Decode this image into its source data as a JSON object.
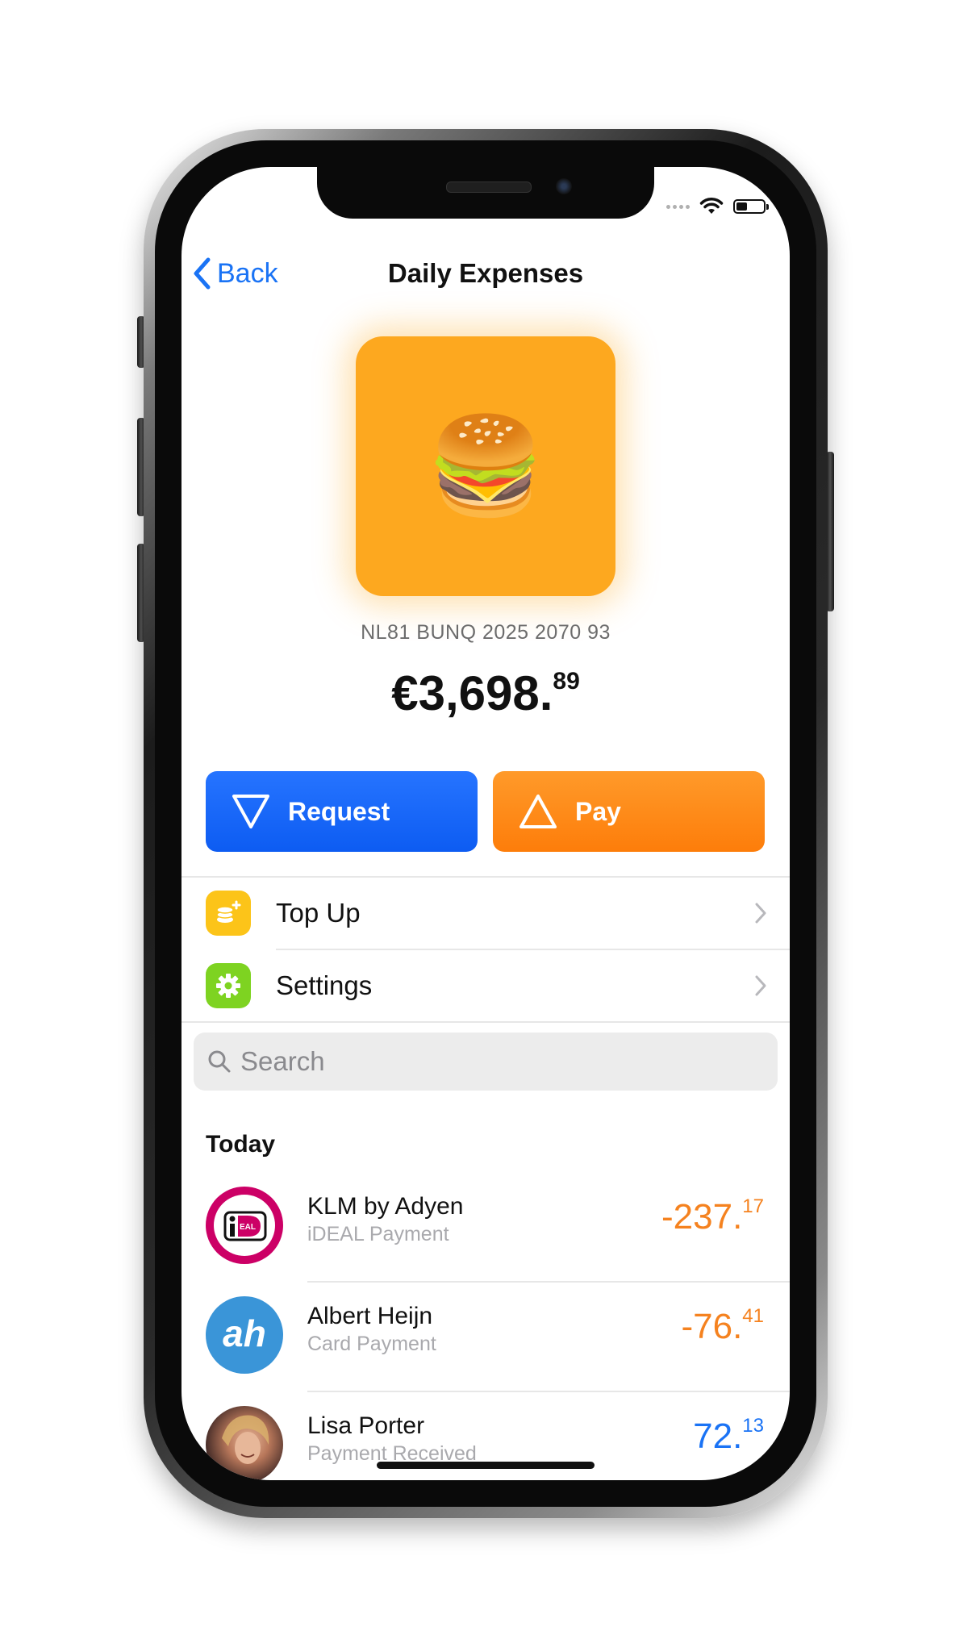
{
  "status_bar": {
    "signal_icon": "signal-dots-icon",
    "wifi_icon": "wifi-icon",
    "battery_icon": "battery-icon"
  },
  "nav": {
    "back_label": "Back",
    "title": "Daily Expenses"
  },
  "account": {
    "emoji": "🍔",
    "tile_color": "#fda81f",
    "iban": "NL81 BUNQ 2025 2070 93",
    "balance_main": "€3,698.",
    "balance_cents": "89"
  },
  "actions": {
    "request_label": "Request",
    "pay_label": "Pay",
    "request_color": "#1a6cf7",
    "pay_color": "#fd8a15"
  },
  "menu": [
    {
      "label": "Top Up",
      "icon": "coins-icon",
      "color": "#fcc419"
    },
    {
      "label": "Settings",
      "icon": "gear-icon",
      "color": "#7ed321"
    }
  ],
  "search": {
    "placeholder": "Search"
  },
  "transactions": {
    "section_title": "Today",
    "items": [
      {
        "name": "KLM by Adyen",
        "subtitle": "iDEAL Payment",
        "amount_main": "-237.",
        "amount_cents": "17",
        "color": "#f5821f",
        "avatar": "ideal-logo"
      },
      {
        "name": "Albert Heijn",
        "subtitle": "Card Payment",
        "amount_main": "-76.",
        "amount_cents": "41",
        "color": "#f5821f",
        "avatar": "albert-heijn-logo"
      },
      {
        "name": "Lisa Porter",
        "subtitle": "Payment Received",
        "amount_main": "72.",
        "amount_cents": "13",
        "color": "#1a73f5",
        "avatar": "user-photo"
      }
    ]
  }
}
